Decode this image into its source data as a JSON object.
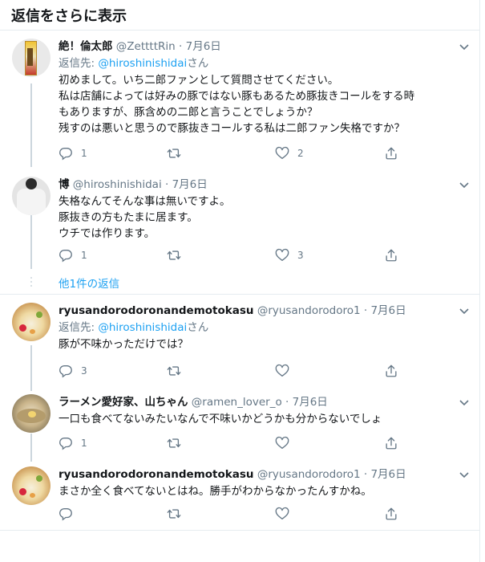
{
  "header": {
    "title": "返信をさらに表示"
  },
  "tweets": [
    {
      "name": "絶！倫太郎",
      "handle": "@ZettttRin",
      "date": "7月6日",
      "reply_prefix": "返信先: ",
      "reply_mention": "@hiroshinishidai",
      "reply_suffix": "さん",
      "lines": [
        "初めまして。いち二郎ファンとして質問させてください。",
        "私は店舗によっては好みの豚ではない豚もあるため豚抜きコールをする時",
        "もありますが、豚含めの二郎と言うことでしょうか？",
        "残すのは悪いと思うので豚抜きコールする私は二郎ファン失格ですか？"
      ],
      "reply_count": "1",
      "retweet_count": "",
      "like_count": "2"
    },
    {
      "name": "博",
      "handle": "@hiroshinishidai",
      "date": "7月6日",
      "lines": [
        "失格なんてそんな事は無いですよ。",
        "豚抜きの方もたまに居ます。",
        "ウチでは作ります。"
      ],
      "reply_count": "1",
      "retweet_count": "",
      "like_count": "3"
    },
    {
      "name": "ryusandorodoronandemotokasu",
      "handle": "@ryusandorodoro1",
      "date": "7月6日",
      "reply_prefix": "返信先: ",
      "reply_mention": "@hiroshinishidai",
      "reply_suffix": "さん",
      "lines": [
        "豚が不味かっただけでは？"
      ],
      "reply_count": "3",
      "retweet_count": "",
      "like_count": ""
    },
    {
      "name": "ラーメン愛好家、山ちゃん",
      "handle": "@ramen_lover_o",
      "date": "7月6日",
      "lines": [
        "一口も食べてないみたいなんで不味いかどうかも分からないでしょ"
      ],
      "reply_count": "1",
      "retweet_count": "",
      "like_count": ""
    },
    {
      "name": "ryusandorodoronandemotokasu",
      "handle": "@ryusandorodoro1",
      "date": "7月6日",
      "lines": [
        "まさか全く食べてないとはね。勝手がわからなかったんすかね。"
      ],
      "reply_count": "",
      "retweet_count": "",
      "like_count": ""
    }
  ],
  "more_replies": "他1件の返信",
  "meta_separator": "·",
  "icons": [
    "reply-icon",
    "retweet-icon",
    "like-icon",
    "share-icon",
    "chevron-down-icon"
  ],
  "colors": {
    "link": "#1da1f2",
    "muted": "#657786",
    "text": "#14171a",
    "border": "#e6ecf0"
  }
}
